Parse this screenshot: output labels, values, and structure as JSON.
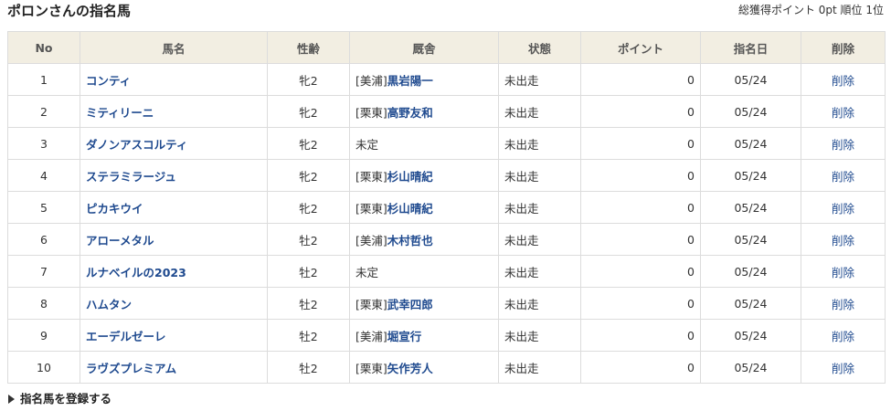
{
  "header": {
    "title": "ポロンさんの指名馬",
    "summary": "総獲得ポイント 0pt 順位 1位"
  },
  "table": {
    "columns": [
      "No",
      "馬名",
      "性齢",
      "厩舎",
      "状態",
      "ポイント",
      "指名日",
      "削除"
    ],
    "rows": [
      {
        "no": "1",
        "name": "コンティ",
        "sex_age": "牝2",
        "stable_prefix": "[美浦]",
        "trainer": "黒岩陽一",
        "status": "未出走",
        "points": "0",
        "date": "05/24",
        "delete": "削除"
      },
      {
        "no": "2",
        "name": "ミティリーニ",
        "sex_age": "牝2",
        "stable_prefix": "[栗東]",
        "trainer": "高野友和",
        "status": "未出走",
        "points": "0",
        "date": "05/24",
        "delete": "削除"
      },
      {
        "no": "3",
        "name": "ダノンアスコルティ",
        "sex_age": "牝2",
        "stable_prefix": "",
        "trainer": "",
        "stable_text": "未定",
        "status": "未出走",
        "points": "0",
        "date": "05/24",
        "delete": "削除"
      },
      {
        "no": "4",
        "name": "ステラミラージュ",
        "sex_age": "牝2",
        "stable_prefix": "[栗東]",
        "trainer": "杉山晴紀",
        "status": "未出走",
        "points": "0",
        "date": "05/24",
        "delete": "削除"
      },
      {
        "no": "5",
        "name": "ピカキウイ",
        "sex_age": "牝2",
        "stable_prefix": "[栗東]",
        "trainer": "杉山晴紀",
        "status": "未出走",
        "points": "0",
        "date": "05/24",
        "delete": "削除"
      },
      {
        "no": "6",
        "name": "アローメタル",
        "sex_age": "牡2",
        "stable_prefix": "[美浦]",
        "trainer": "木村哲也",
        "status": "未出走",
        "points": "0",
        "date": "05/24",
        "delete": "削除"
      },
      {
        "no": "7",
        "name": "ルナベイルの2023",
        "sex_age": "牡2",
        "stable_prefix": "",
        "trainer": "",
        "stable_text": "未定",
        "status": "未出走",
        "points": "0",
        "date": "05/24",
        "delete": "削除"
      },
      {
        "no": "8",
        "name": "ハムタン",
        "sex_age": "牡2",
        "stable_prefix": "[栗東]",
        "trainer": "武幸四郎",
        "status": "未出走",
        "points": "0",
        "date": "05/24",
        "delete": "削除"
      },
      {
        "no": "9",
        "name": "エーデルゼーレ",
        "sex_age": "牡2",
        "stable_prefix": "[美浦]",
        "trainer": "堀宣行",
        "status": "未出走",
        "points": "0",
        "date": "05/24",
        "delete": "削除"
      },
      {
        "no": "10",
        "name": "ラヴズプレミアム",
        "sex_age": "牡2",
        "stable_prefix": "[栗東]",
        "trainer": "矢作芳人",
        "status": "未出走",
        "points": "0",
        "date": "05/24",
        "delete": "削除"
      }
    ]
  },
  "footer": {
    "register_link": "指名馬を登録する",
    "register_icon": "triangle-right-icon"
  },
  "colors": {
    "header_bg": "#f2eee2",
    "link": "#1f4a8f",
    "border": "#dcdcdc"
  }
}
